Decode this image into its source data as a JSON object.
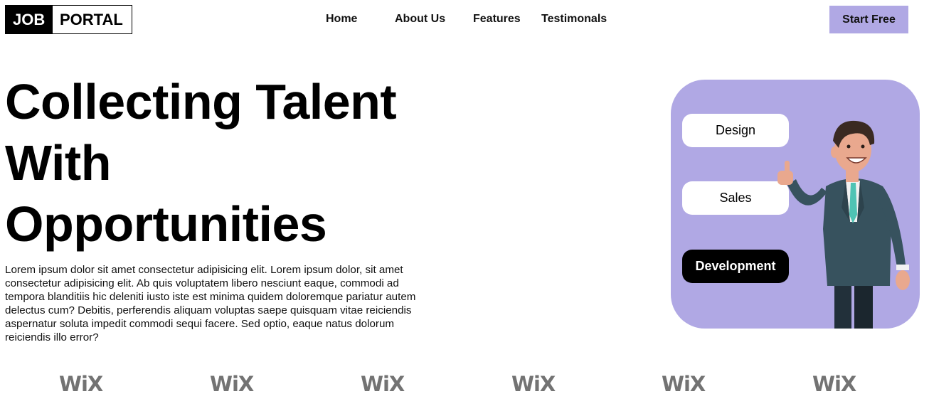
{
  "header": {
    "logo_part1": "JOB",
    "logo_part2": "PORTAL",
    "nav": [
      {
        "label": "Home"
      },
      {
        "label": "About Us"
      },
      {
        "label": "Features"
      },
      {
        "label": "Testimonals"
      }
    ],
    "cta_label": "Start Free"
  },
  "hero": {
    "title_lines": [
      "Collecting Talent",
      "With",
      "Opportunities"
    ],
    "paragraph": "Lorem ipsum dolor sit amet consectetur adipisicing elit. Lorem ipsum dolor, sit amet consectetur adipisicing elit. Ab quis voluptatem libero nesciunt eaque, commodi ad tempora blanditiis hic deleniti iusto iste est minima quidem doloremque pariatur autem delectus cum? Debitis, perferendis aliquam voluptas saepe quisquam vitae reiciendis aspernatur soluta impedit commodi sequi facere. Sed optio, eaque natus dolorum reiciendis illo error?"
  },
  "card": {
    "categories": [
      {
        "label": "Design",
        "style": "light"
      },
      {
        "label": "Sales",
        "style": "light"
      },
      {
        "label": "Development",
        "style": "dark"
      }
    ],
    "illustration": "businessman-thumbs-up-illustration"
  },
  "brands": {
    "logos": [
      "WiX",
      "WiX",
      "WiX",
      "WiX",
      "WiX",
      "WiX"
    ]
  },
  "colors": {
    "accent": "#b0a8e4",
    "brand_gray": "#737373",
    "text": "#000000"
  }
}
